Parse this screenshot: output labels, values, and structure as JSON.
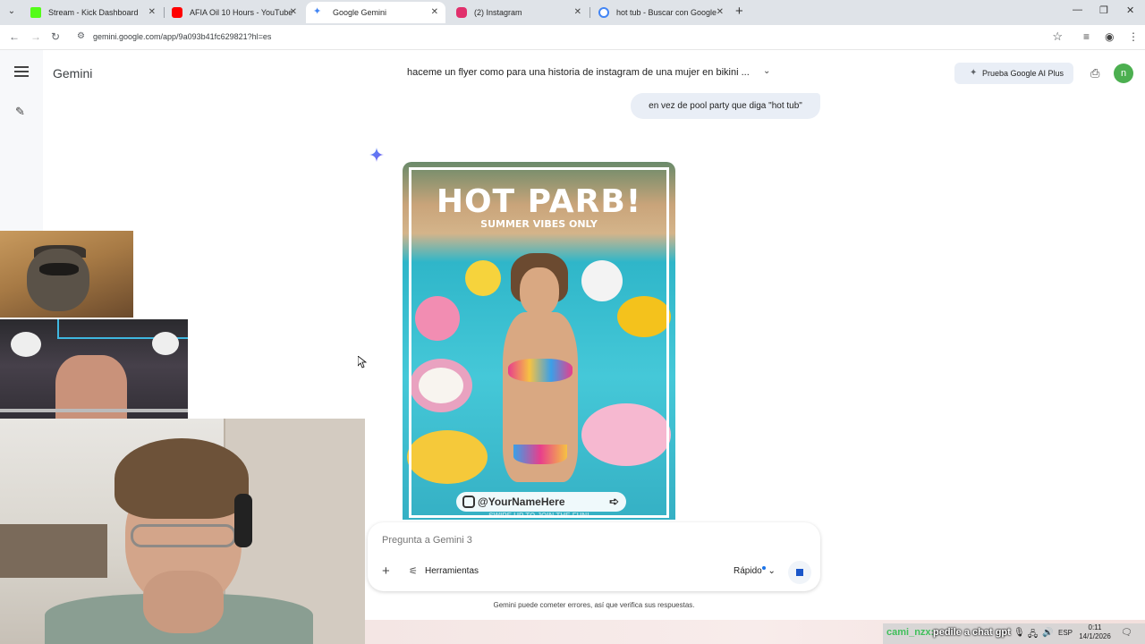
{
  "browser": {
    "tabs": [
      {
        "title": "Stream - Kick Dashboard",
        "favicon_color": "#53fc18",
        "active": false
      },
      {
        "title": "AFIA Oil 10 Hours - YouTube",
        "favicon_color": "#ff0000",
        "active": false
      },
      {
        "title": "Google Gemini",
        "favicon_color": "#4285f4",
        "active": true
      },
      {
        "title": "(2) Instagram",
        "favicon_color": "#e1306c",
        "active": false
      },
      {
        "title": "hot tub - Buscar con Google",
        "favicon_color": "#4285f4",
        "active": false
      }
    ],
    "url": "gemini.google.com/app/9a093b41fc629821?hl=es",
    "close_glyph": "✕",
    "new_tab_glyph": "+"
  },
  "gemini": {
    "brand": "Gemini",
    "conversation_title": "haceme un flyer como para una historia de instagram de una mujer en bikini ...",
    "upgrade_button": "Prueba Google AI Plus",
    "avatar_letter": "n",
    "user_message": "en vez de pool party que diga \"hot tub\"",
    "flyer": {
      "headline": "HOT PARB!",
      "subline": "SUMMER VIBES ONLY",
      "handle": "@YourNameHere",
      "bottom_text": "SWIPE UP TO JOIN THE FUN!"
    },
    "prompt": {
      "placeholder": "Pregunta a Gemini 3",
      "tools_label": "Herramientas",
      "model_label": "Rápido"
    },
    "disclaimer": "Gemini puede cometer errores, así que verifica sus respuestas."
  },
  "overlay": {
    "chat_user": "cami_nzx:",
    "chat_message": "pedile a chat gpt"
  },
  "taskbar": {
    "language": "ESP",
    "time": "0:11",
    "date": "14/1/2026"
  },
  "colors": {
    "accent_blue": "#1a73e8",
    "avatar_green": "#4caf50",
    "bubble_bg": "#e9eef6"
  }
}
